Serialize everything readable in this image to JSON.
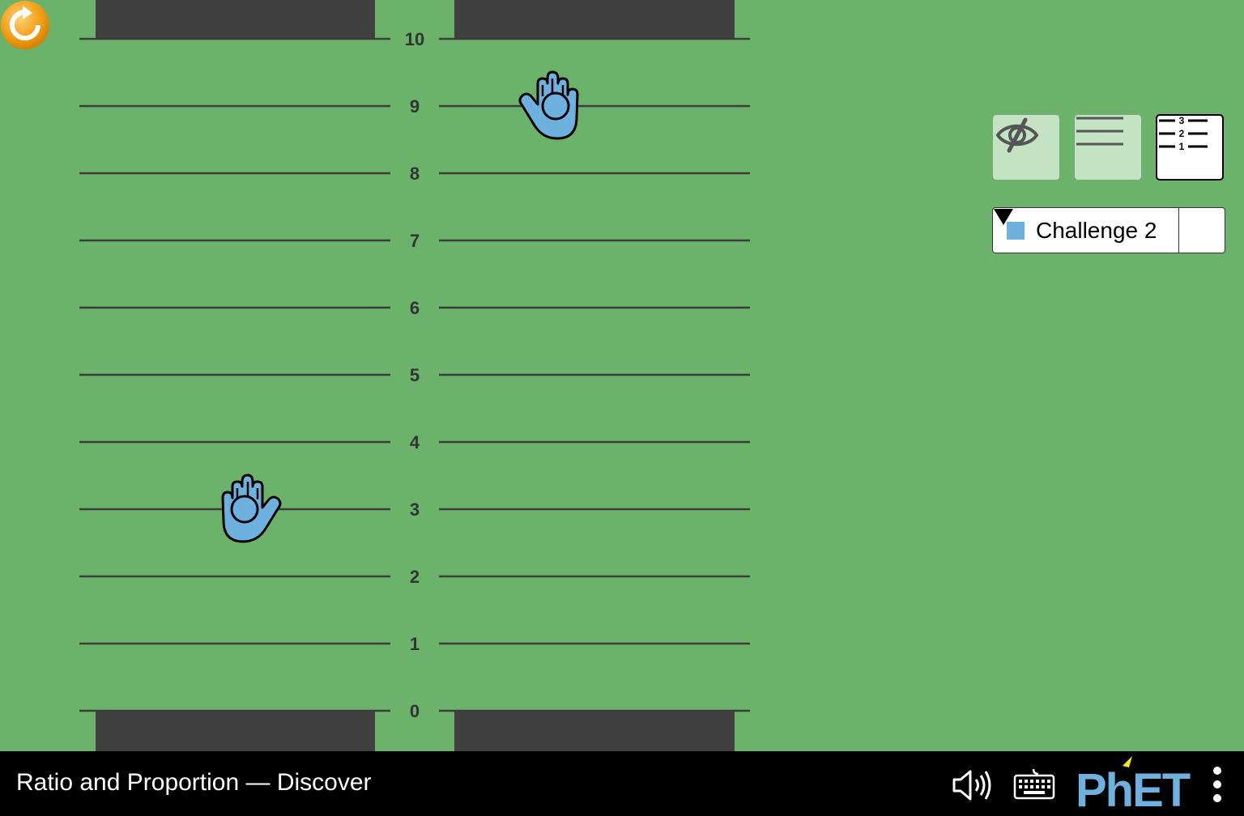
{
  "scale": {
    "min": 0,
    "max": 10,
    "tick_labels": [
      "0",
      "1",
      "2",
      "3",
      "4",
      "5",
      "6",
      "7",
      "8",
      "9",
      "10"
    ]
  },
  "left_hand": {
    "value": 3,
    "color": "#6fb1de"
  },
  "right_hand": {
    "value": 9,
    "color": "#6fb1de"
  },
  "controls": {
    "visibility_toggle": "eye-slash-icon",
    "gridlines_button": "gridlines-icon",
    "tick_marks_button": "numbered-tick-marks-icon",
    "tick_marks_selected": true
  },
  "challenge_selector": {
    "selected": "Challenge 2",
    "swatch_color": "#6fb1de"
  },
  "reset_color": "#f4a21a",
  "navbar": {
    "title": "Ratio and Proportion — Discover",
    "brand": "PhET",
    "brand_color": "#6fb1de",
    "accent_color": "#f2e916"
  }
}
